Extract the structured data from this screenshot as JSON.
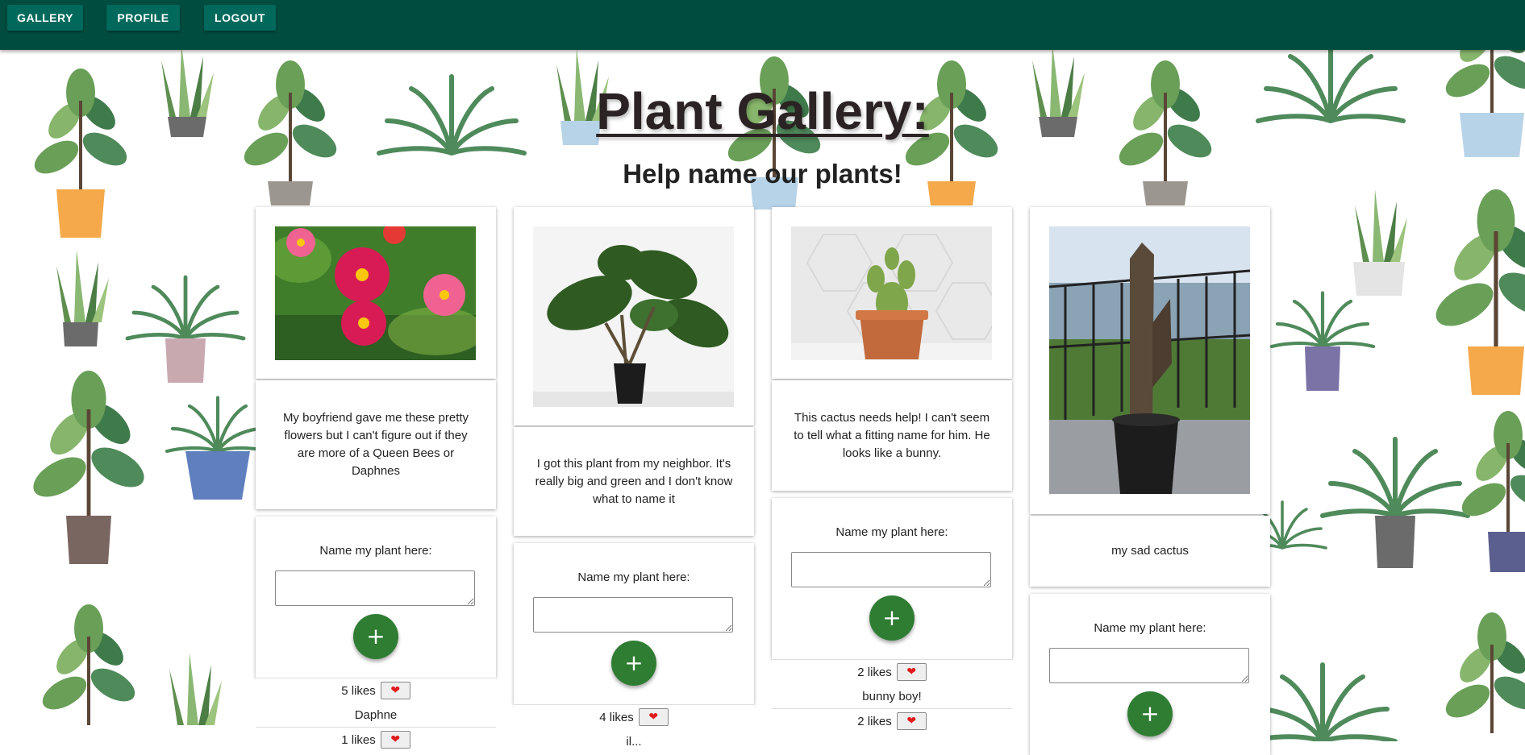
{
  "nav": {
    "gallery": "GALLERY",
    "profile": "PROFILE",
    "logout": "LOGOUT"
  },
  "page": {
    "title": "Plant Gallery:",
    "subtitle": "Help name our plants!"
  },
  "colors": {
    "navbar": "#004d40",
    "nav_button": "#00695c",
    "add_button": "#2e7d32",
    "heart": "#e01b1b"
  },
  "cards": [
    {
      "image": "pink dahlia flowers",
      "description": "My boyfriend gave me these pretty flowers but I can't figure out if they are more of a Queen Bees or Daphnes",
      "form_label": "Name my plant here:",
      "input_value": "",
      "add_icon": "+",
      "suggestions": [
        {
          "likes": "5 likes",
          "name": "Daphne"
        },
        {
          "likes": "1 likes",
          "name": ""
        }
      ]
    },
    {
      "image": "monstera houseplant in black pot",
      "description": "I got this plant from my neighbor. It's really big and green and I don't know what to name it",
      "form_label": "Name my plant here:",
      "input_value": "",
      "add_icon": "+",
      "suggestions": [
        {
          "likes": "4 likes",
          "name": "il..."
        }
      ]
    },
    {
      "image": "bunny ear cactus in terracotta pot",
      "description": "This cactus needs help! I can't seem to tell what a fitting name for him. He looks like a bunny.",
      "form_label": "Name my plant here:",
      "input_value": "",
      "add_icon": "+",
      "suggestions": [
        {
          "likes": "2 likes",
          "name": "bunny boy!"
        },
        {
          "likes": "2 likes",
          "name": ""
        }
      ]
    },
    {
      "image": "tall dried cactus on balcony",
      "description": "my sad cactus",
      "form_label": "Name my plant here:",
      "input_value": "",
      "add_icon": "+",
      "suggestions": []
    }
  ],
  "icons": {
    "heart": "heart-icon",
    "plus": "plus-icon"
  }
}
